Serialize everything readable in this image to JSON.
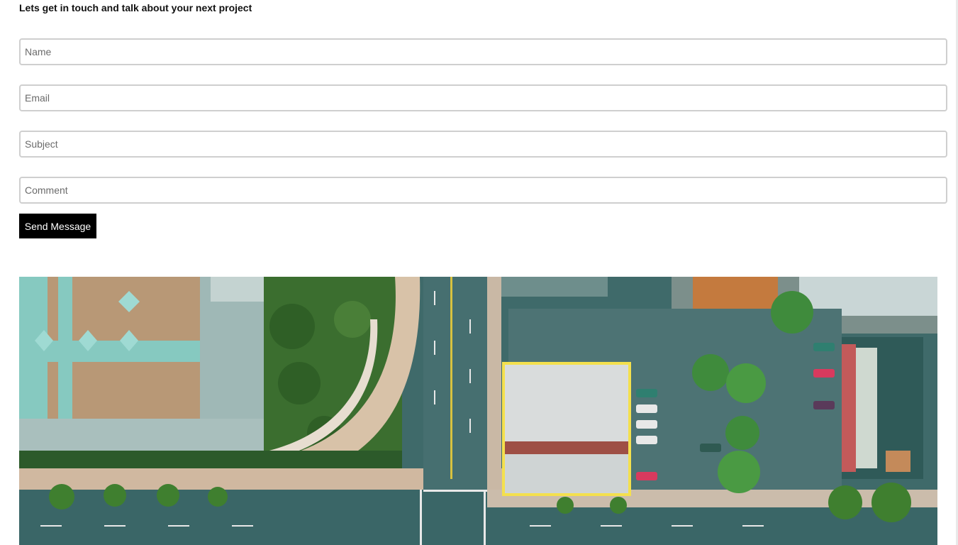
{
  "contact": {
    "heading": "Lets get in touch and talk about your next project",
    "fields": {
      "name_placeholder": "Name",
      "email_placeholder": "Email",
      "subject_placeholder": "Subject",
      "comment_placeholder": "Comment"
    },
    "send_label": "Send Message"
  },
  "image": {
    "icon": "aerial-city-photo"
  },
  "colors": {
    "button_bg": "#000000",
    "field_border": "#cfcfcf",
    "highlight_outline": "#f4e04d"
  }
}
